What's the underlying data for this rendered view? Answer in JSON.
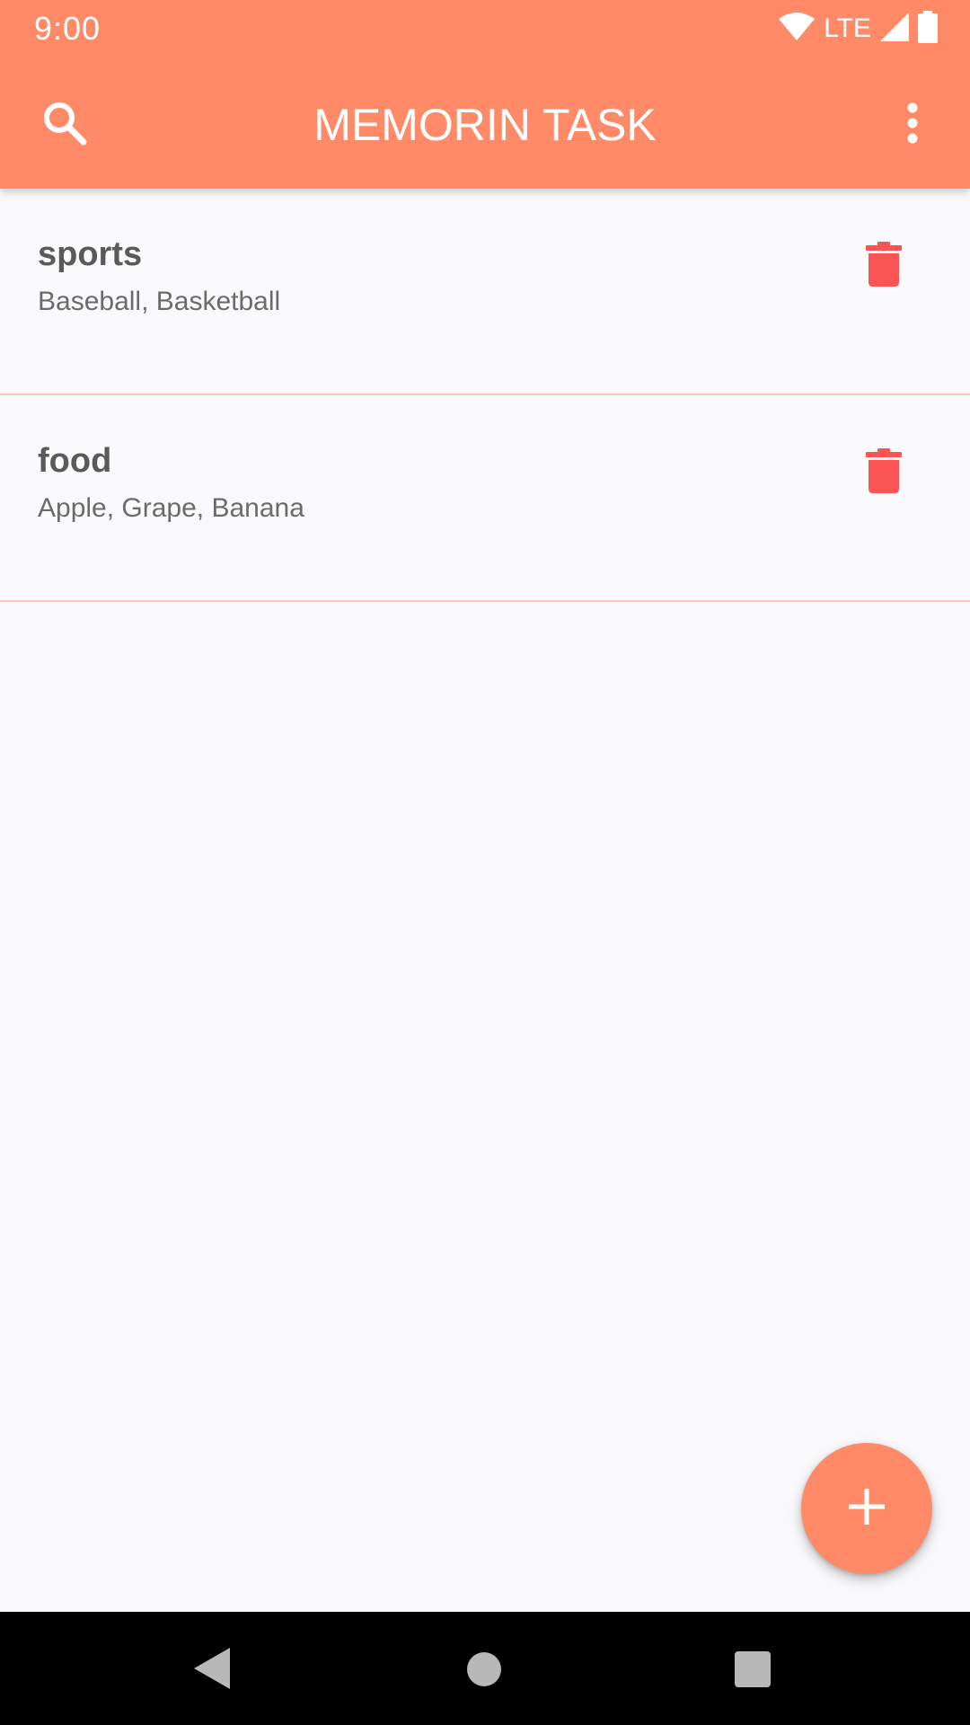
{
  "status_bar": {
    "time": "9:00",
    "network_label": "LTE",
    "icons": [
      "wifi-icon",
      "signal-icon",
      "battery-icon"
    ]
  },
  "app_bar": {
    "title": "MEMORIN TASK",
    "left_icon": "search-icon",
    "right_icon": "more-vert-icon"
  },
  "tasks": [
    {
      "title": "sports",
      "items": "Baseball, Basketball",
      "action_icon": "delete-icon"
    },
    {
      "title": "food",
      "items": "Apple, Grape, Banana",
      "action_icon": "delete-icon"
    }
  ],
  "fab": {
    "icon": "add-icon"
  },
  "nav_bar": {
    "icons": [
      "back-icon",
      "home-icon",
      "recents-icon"
    ]
  },
  "colors": {
    "accent": "#ff8a67",
    "delete": "#fa5454",
    "divider": "#ffc6b7",
    "background": "#faf9fb",
    "title_text": "#5a5a5a",
    "subtitle_text": "#6b6b6b"
  }
}
